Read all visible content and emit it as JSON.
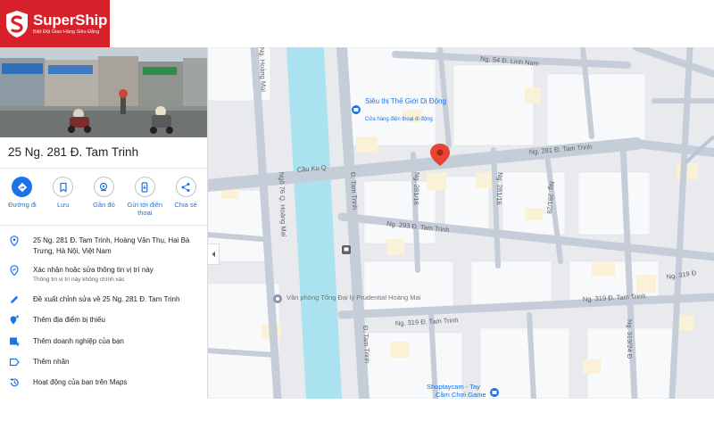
{
  "brand": {
    "name": "SuperShip",
    "tagline": "Biệt Đội Giao Hàng Siêu Đẳng",
    "color": "#d8202a"
  },
  "place": {
    "title": "25 Ng. 281 Đ. Tam Trinh"
  },
  "actions": [
    {
      "label": "Đường đi",
      "icon": "directions-icon"
    },
    {
      "label": "Lưu",
      "icon": "bookmark-icon"
    },
    {
      "label": "Gần đó",
      "icon": "nearby-icon"
    },
    {
      "label": "Gửi tới điện thoại",
      "icon": "send-to-phone-icon"
    },
    {
      "label": "Chia sẻ",
      "icon": "share-icon"
    }
  ],
  "info": {
    "address": "25 Ng. 281 Đ. Tam Trinh, Hoàng Văn Thụ, Hai Bà Trưng, Hà Nội, Việt Nam",
    "verify_title": "Xác nhận hoặc sửa thông tin vị trí này",
    "verify_sub": "Thông tin vị trí này không chính xác",
    "suggest_edit": "Đề xuất chỉnh sửa về 25 Ng. 281 Đ. Tam Trinh",
    "add_place": "Thêm địa điểm bị thiếu",
    "add_business": "Thêm doanh nghiệp của bạn",
    "add_label": "Thêm nhãn",
    "maps_activity": "Hoạt động của bạn trên Maps"
  },
  "map": {
    "streets": {
      "linh_nam": "Ng. 54 Đ. Linh Nam",
      "hoang_mai_left": "Ng. Hoàng Mai",
      "ng76": "Ngõ 76 Q. Hoàng Mai",
      "tam_trinh_west": "Đ. Tam Trinh",
      "tam_trinh_east": "Đ. Tam Trinh",
      "cau_ku": "Cầu Ku Q",
      "ng281": "Ng. 281 Đ. Tam Trinh",
      "ng293": "Ng. 293 Đ. Tam Trinh",
      "ng319": "Ng. 319 Đ. Tam Trinh",
      "ng319b": "Ng. 319 Đ. Tam Trinh",
      "ng281_28": "Ng. 281/28",
      "ng281_16": "Ng. 281/16",
      "ng281_16b": "Ng. 281/16",
      "ng319_24": "Ng. 319/24 Đ",
      "ng319_b": "Ng. 319 Đ"
    },
    "poi": {
      "sieu_thi_name": "Siêu thị Thế Giới Di Động",
      "sieu_thi_sub": "Cửa hàng điện thoại di động",
      "van_phong": "Văn phòng Tổng Đại lý Prudential Hoàng Mai",
      "shoptay_1": "Shoptaycam - Tay",
      "shoptay_2": "Cầm Chơi Game"
    },
    "colors": {
      "water": "#aae3ef",
      "road": "#c5cdd8",
      "block": "#e8eaed",
      "building_yellow": "#faf1d6",
      "pin": "#e94335",
      "poi_blue": "#1a73e8"
    }
  }
}
